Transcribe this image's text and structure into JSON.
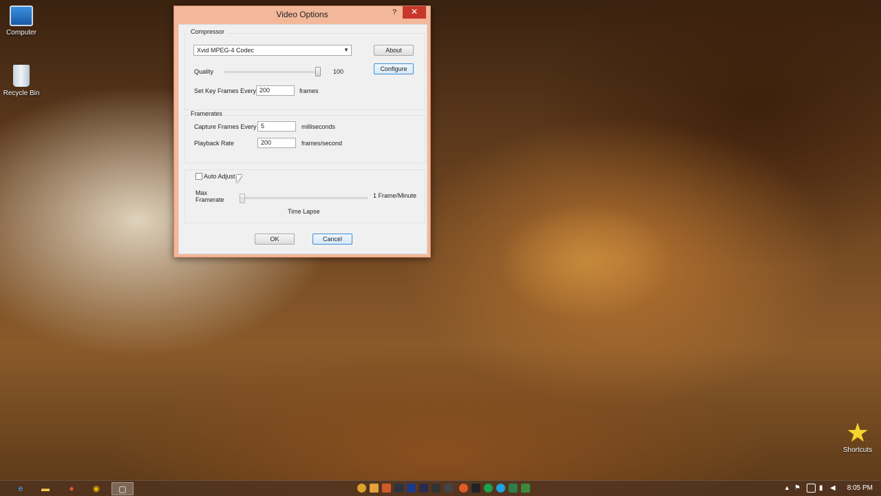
{
  "desktop": {
    "icons": [
      {
        "label": "Computer"
      },
      {
        "label": "Recycle Bin"
      },
      {
        "label": "Shortcuts"
      }
    ]
  },
  "dialog": {
    "title": "Video Options",
    "help": "?",
    "close": "✕",
    "compressor": {
      "group_title": "Compressor",
      "codec_selected": "Xvid MPEG-4 Codec",
      "about_label": "About",
      "configure_label": "Configure",
      "quality_label": "Quality",
      "quality_value": "100",
      "quality_fraction": 1.0,
      "keyframes_label": "Set Key Frames Every",
      "keyframes_value": "200",
      "keyframes_unit": "frames"
    },
    "framerates": {
      "group_title": "Framerates",
      "capture_label": "Capture Frames Every",
      "capture_value": "5",
      "capture_unit": "milliseconds",
      "playback_label": "Playback Rate",
      "playback_value": "200",
      "playback_unit": "frames/second"
    },
    "auto": {
      "auto_adjust_label": "Auto Adjust",
      "auto_adjust_checked": false,
      "max_framerate_label_1": "Max",
      "max_framerate_label_2": "Framerate",
      "slider_right_label": "1 Frame/Minute",
      "slider_bottom_label": "Time Lapse",
      "slider_fraction": 0.0
    },
    "ok_label": "OK",
    "cancel_label": "Cancel"
  },
  "taskbar": {
    "clock": "8:05 PM"
  },
  "colors": {
    "close_red": "#c7372c",
    "dialog_frame": "#f3b89a",
    "focus_blue": "#3c8fd8"
  }
}
